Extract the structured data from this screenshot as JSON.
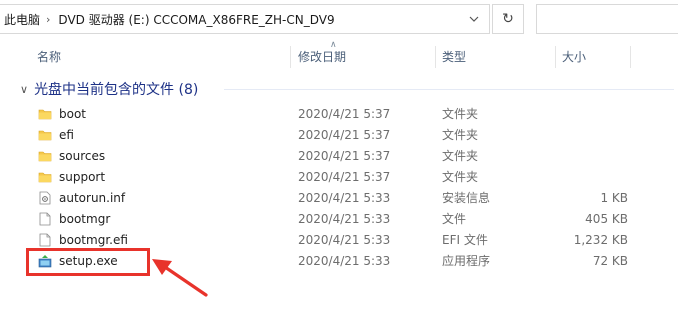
{
  "address_bar": {
    "crumbs": [
      "此电脑",
      "DVD 驱动器 (E:) CCCOMA_X86FRE_ZH-CN_DV9"
    ],
    "dropdown_icon": "chevron-down-icon",
    "refresh_icon": "refresh-icon"
  },
  "columns": {
    "name": "名称",
    "date": "修改日期",
    "type": "类型",
    "size": "大小"
  },
  "group": {
    "label": "光盘中当前包含的文件 (8)"
  },
  "files": [
    {
      "name": "boot",
      "date": "2020/4/21 5:37",
      "type": "文件夹",
      "size": "",
      "icon": "folder-icon"
    },
    {
      "name": "efi",
      "date": "2020/4/21 5:37",
      "type": "文件夹",
      "size": "",
      "icon": "folder-icon"
    },
    {
      "name": "sources",
      "date": "2020/4/21 5:37",
      "type": "文件夹",
      "size": "",
      "icon": "folder-icon"
    },
    {
      "name": "support",
      "date": "2020/4/21 5:37",
      "type": "文件夹",
      "size": "",
      "icon": "folder-icon"
    },
    {
      "name": "autorun.inf",
      "date": "2020/4/21 5:33",
      "type": "安装信息",
      "size": "1 KB",
      "icon": "settings-file-icon"
    },
    {
      "name": "bootmgr",
      "date": "2020/4/21 5:33",
      "type": "文件",
      "size": "405 KB",
      "icon": "file-icon"
    },
    {
      "name": "bootmgr.efi",
      "date": "2020/4/21 5:33",
      "type": "EFI 文件",
      "size": "1,232 KB",
      "icon": "file-icon"
    },
    {
      "name": "setup.exe",
      "date": "2020/4/21 5:33",
      "type": "应用程序",
      "size": "72 KB",
      "icon": "setup-app-icon"
    }
  ],
  "annotation": {
    "highlight_color": "#e8332b",
    "target": "setup.exe"
  }
}
